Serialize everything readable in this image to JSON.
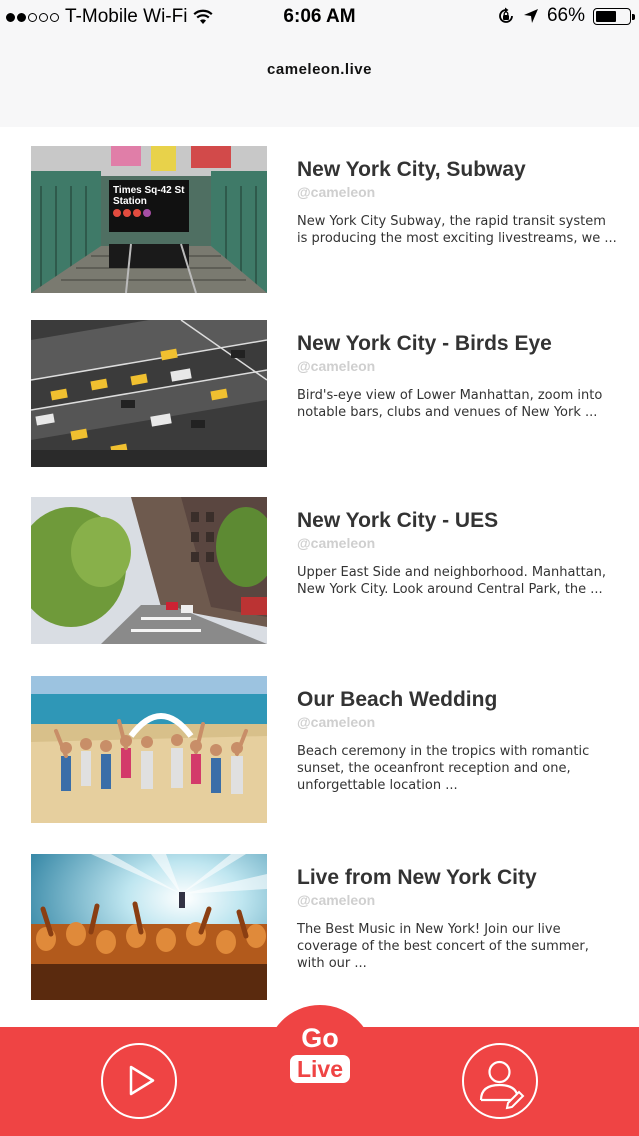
{
  "status_bar": {
    "carrier": "T-Mobile Wi-Fi",
    "signal_bars_filled": 2,
    "signal_bars_total": 5,
    "time": "6:06 AM",
    "battery_percent": "66%",
    "battery_level": 0.66,
    "icons": [
      "wifi-icon",
      "rotation-lock-icon",
      "location-arrow-icon",
      "battery-icon"
    ]
  },
  "nav": {
    "title": "cameleon.live"
  },
  "streams": [
    {
      "title": "New York City, Subway",
      "handle": "@cameleon",
      "description": "New York City Subway, the rapid transit system is producing the most exciting livestreams, we ...",
      "thumbnail": "subway-entrance-image",
      "sign_lines": [
        "Times Sq-42 St",
        "Station"
      ]
    },
    {
      "title": "New York City - Birds Eye",
      "handle": "@cameleon",
      "description": "Bird's-eye view of Lower Manhattan, zoom into notable bars, clubs and venues of New York ...",
      "thumbnail": "aerial-street-image"
    },
    {
      "title": "New York City - UES",
      "handle": "@cameleon",
      "description": "Upper East Side and neighborhood. Manhattan, New York City. Look around Central Park, the ...",
      "thumbnail": "upper-east-side-street-image"
    },
    {
      "title": "Our Beach Wedding",
      "handle": "@cameleon",
      "description": "Beach ceremony in the tropics with romantic sunset, the oceanfront reception and one, unforgettable location ...",
      "thumbnail": "beach-wedding-image"
    },
    {
      "title": "Live  from New York City",
      "handle": "@cameleon",
      "description": "The Best Music in New York! Join our live coverage of the best concert of the summer, with our ...",
      "thumbnail": "concert-crowd-image"
    }
  ],
  "tab_bar": {
    "go_label": "Go",
    "live_label": "Live",
    "left_icon": "play-icon",
    "right_icon": "profile-edit-icon",
    "accent_color": "#ef4444"
  }
}
